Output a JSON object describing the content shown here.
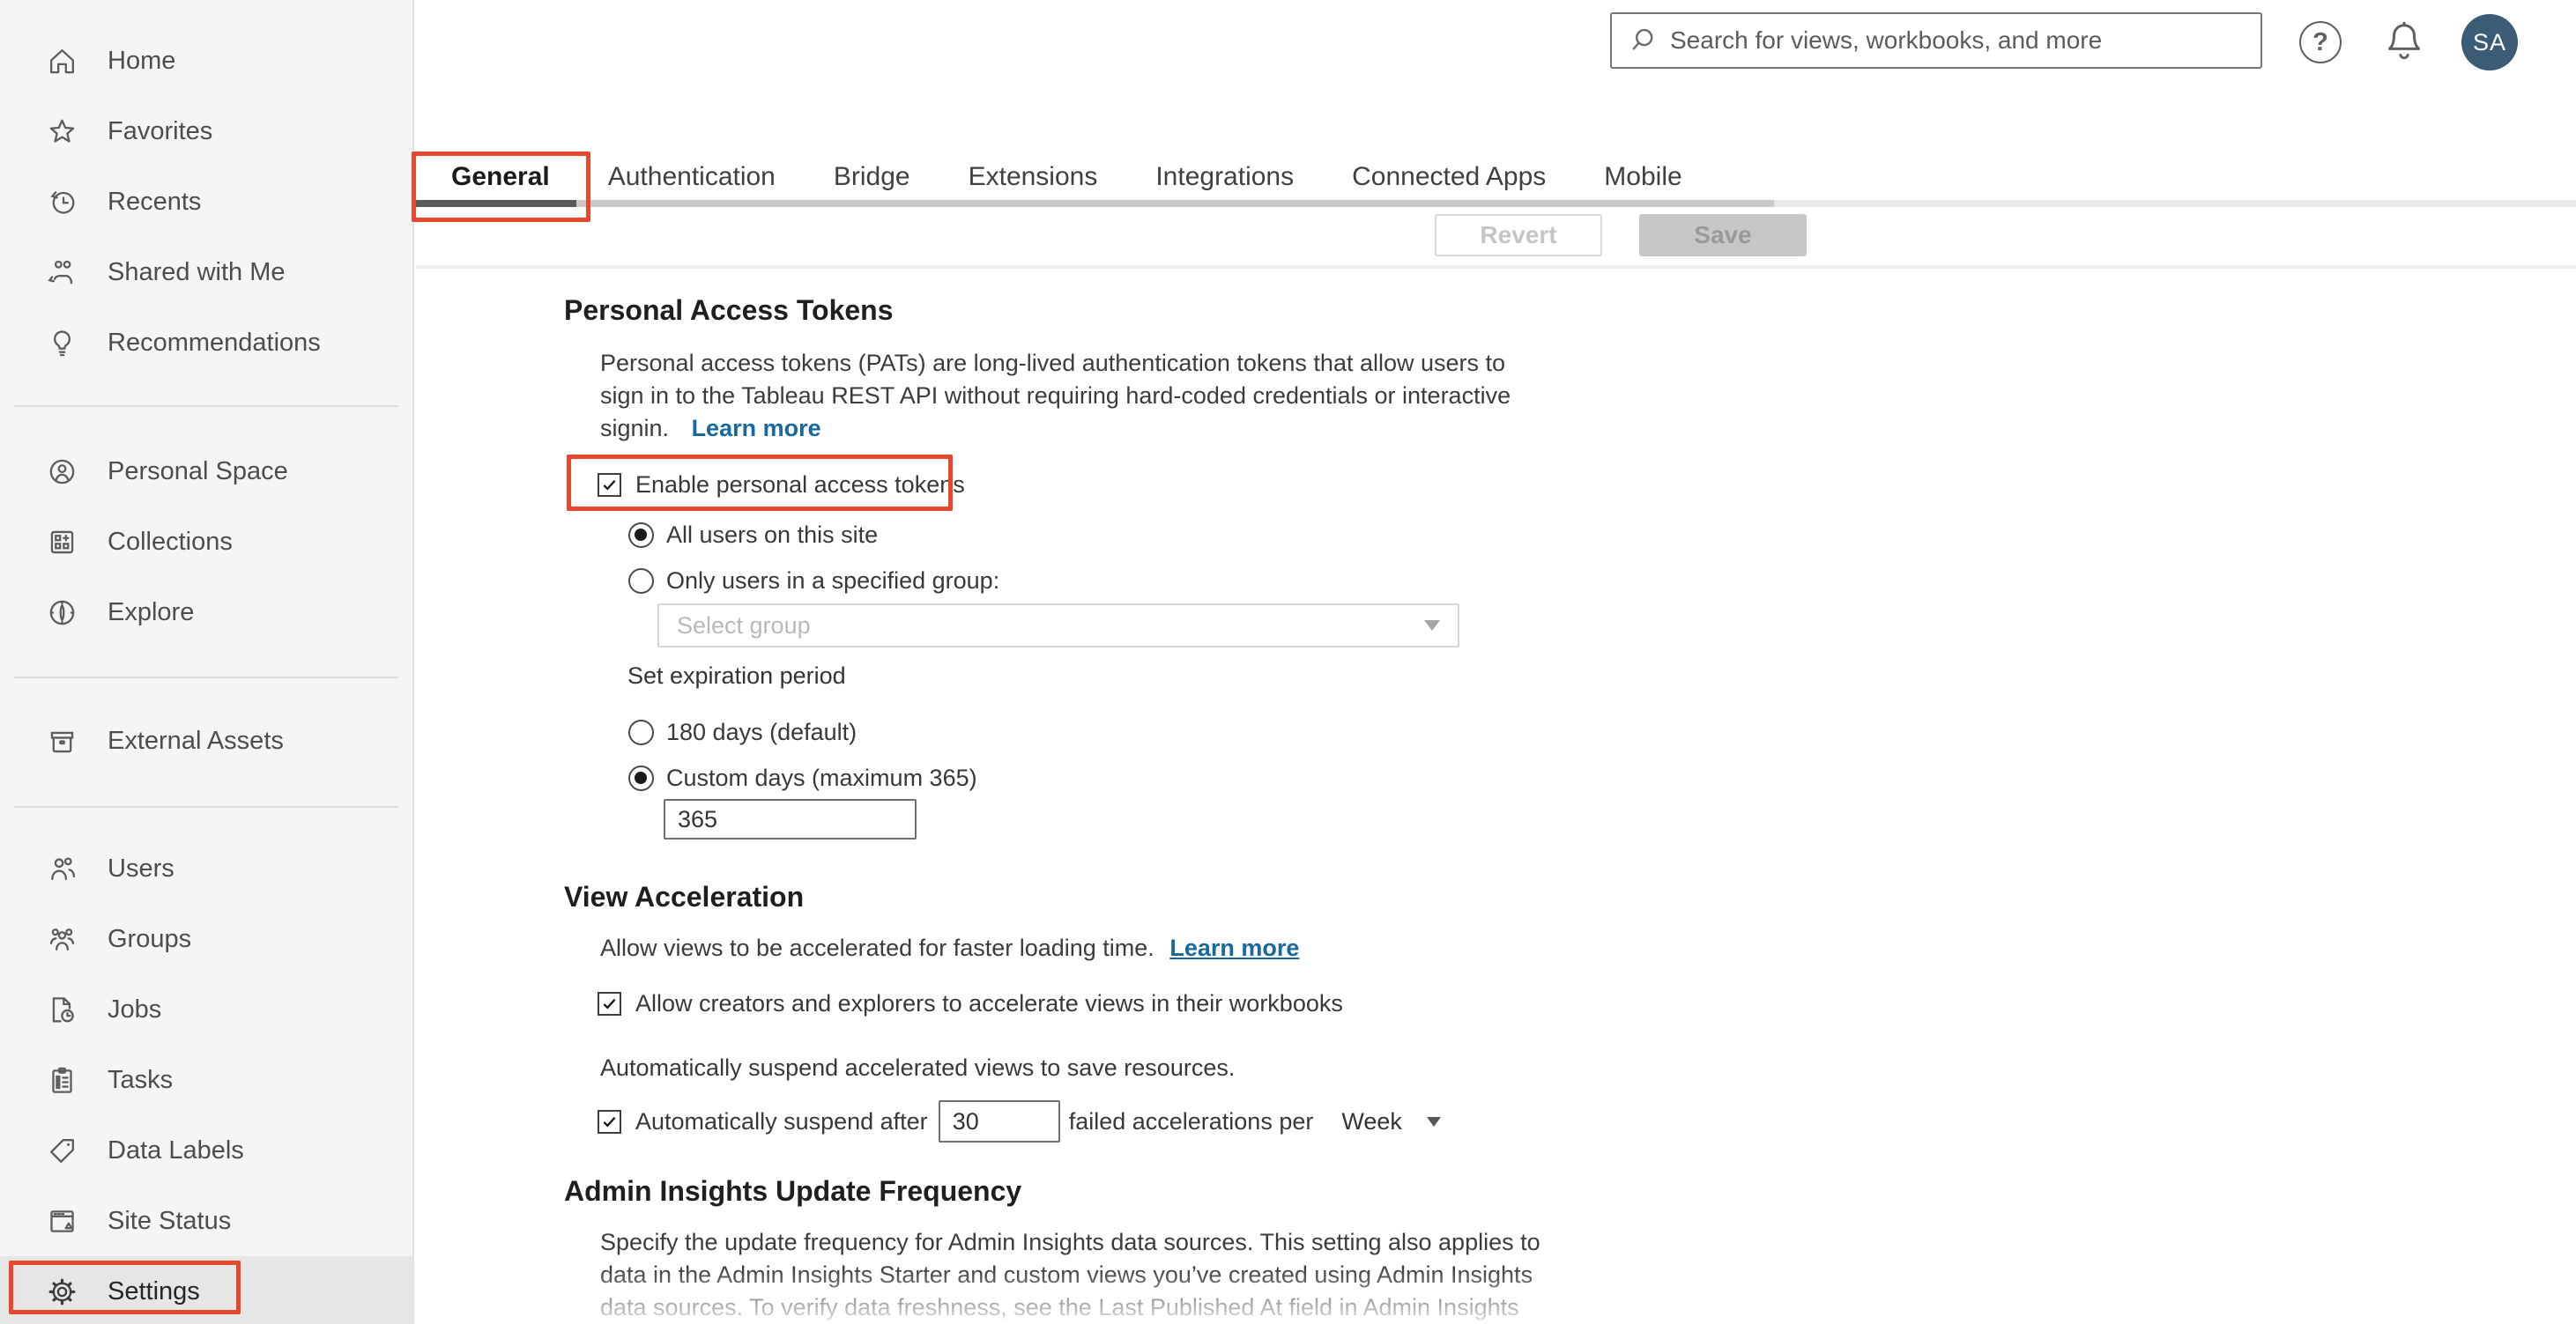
{
  "header": {
    "search_placeholder": "Search for views, workbooks, and more",
    "help_glyph": "?",
    "avatar_initials": "SA"
  },
  "tabs": [
    {
      "label": "General",
      "selected": true
    },
    {
      "label": "Authentication",
      "selected": false
    },
    {
      "label": "Bridge",
      "selected": false
    },
    {
      "label": "Extensions",
      "selected": false
    },
    {
      "label": "Integrations",
      "selected": false
    },
    {
      "label": "Connected Apps",
      "selected": false
    },
    {
      "label": "Mobile",
      "selected": false
    }
  ],
  "actions": {
    "revert_label": "Revert",
    "save_label": "Save",
    "revert_disabled": true,
    "save_disabled": true
  },
  "sidebar": {
    "groups": [
      {
        "items": [
          {
            "icon": "home-icon",
            "label": "Home"
          },
          {
            "icon": "star-icon",
            "label": "Favorites"
          },
          {
            "icon": "recents-icon",
            "label": "Recents"
          },
          {
            "icon": "shared-with-me-icon",
            "label": "Shared with Me"
          },
          {
            "icon": "lightbulb-icon",
            "label": "Recommendations"
          }
        ]
      },
      {
        "items": [
          {
            "icon": "personal-space-icon",
            "label": "Personal Space"
          },
          {
            "icon": "collections-icon",
            "label": "Collections"
          },
          {
            "icon": "compass-icon",
            "label": "Explore"
          }
        ]
      },
      {
        "items": [
          {
            "icon": "external-assets-icon",
            "label": "External Assets"
          }
        ]
      },
      {
        "items": [
          {
            "icon": "users-icon",
            "label": "Users"
          },
          {
            "icon": "groups-icon",
            "label": "Groups"
          },
          {
            "icon": "jobs-icon",
            "label": "Jobs"
          },
          {
            "icon": "tasks-icon",
            "label": "Tasks"
          },
          {
            "icon": "tag-icon",
            "label": "Data Labels"
          },
          {
            "icon": "site-status-icon",
            "label": "Site Status"
          },
          {
            "icon": "gear-icon",
            "label": "Settings",
            "selected": true
          }
        ]
      }
    ]
  },
  "sections": {
    "pat": {
      "title": "Personal Access Tokens",
      "description_lines": [
        "Personal access tokens (PATs) are long-lived authentication tokens that allow users to",
        "sign in to the Tableau REST API without requiring hard-coded credentials or interactive",
        "signin."
      ],
      "learn_more": "Learn more",
      "enable_checkbox_label": "Enable personal access tokens",
      "enable_checked": true,
      "radio_all_users_label": "All users on this site",
      "radio_all_users_selected": true,
      "radio_group_label": "Only users in a specified group:",
      "radio_group_selected": false,
      "group_select_placeholder": "Select group",
      "expiration_label": "Set expiration period",
      "radio_180_label": "180 days (default)",
      "radio_180_selected": false,
      "radio_custom_label": "Custom days (maximum 365)",
      "radio_custom_selected": true,
      "custom_days_value": "365"
    },
    "view_accel": {
      "title": "View Acceleration",
      "intro": "Allow views to be accelerated for faster loading time.",
      "learn_more": "Learn more",
      "checkbox1_label": "Allow creators and explorers to accelerate views in their workbooks",
      "checkbox1_checked": true,
      "suspend_note": "Automatically suspend accelerated views to save resources.",
      "checkbox2_checked": true,
      "suspend_prefix": "Automatically suspend after",
      "suspend_value": "30",
      "suspend_suffix": "failed accelerations per",
      "period_value": "Week"
    },
    "admin_insights": {
      "title": "Admin Insights Update Frequency",
      "description_lines": [
        "Specify the update frequency for Admin Insights data sources. This setting also applies to",
        "data in the Admin Insights Starter and custom views you’ve created using Admin Insights",
        "data sources. To verify data freshness, see the Last Published At field in Admin Insights"
      ]
    }
  },
  "colors": {
    "annotation_red": "#e8472c",
    "link_blue": "#17699e",
    "avatar_bg": "#3a5c74",
    "sidebar_bg": "#f5f5f5",
    "selected_nav_bg": "#e6e6e6",
    "tab_indicator": "#5a5a5a",
    "tab_track": "#c9c9c9",
    "save_button_bg": "#c7c7c7"
  }
}
